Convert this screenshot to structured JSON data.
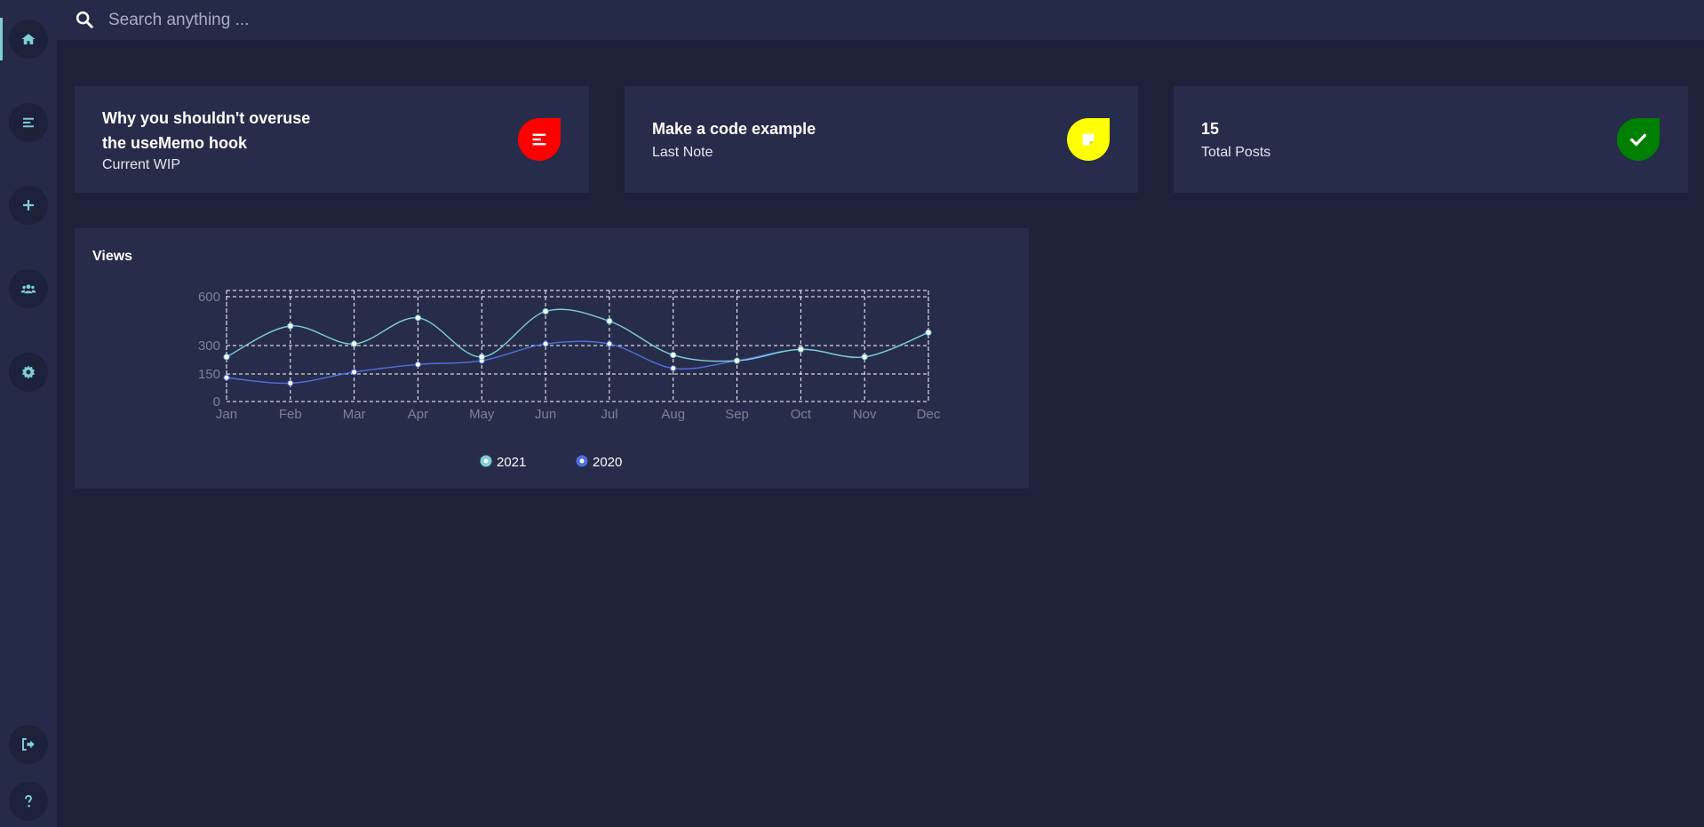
{
  "search": {
    "placeholder": "Search anything ..."
  },
  "sidebar": {
    "items": [
      {
        "name": "home-icon"
      },
      {
        "name": "list-icon"
      },
      {
        "name": "plus-icon"
      },
      {
        "name": "users-icon"
      },
      {
        "name": "gear-icon"
      },
      {
        "name": "logout-icon"
      },
      {
        "name": "help-icon"
      }
    ]
  },
  "cards": [
    {
      "title_line1": "Why you shouldn't overuse",
      "title_line2": "the useMemo hook",
      "subtitle": "Current WIP",
      "badge_color": "#ff0000",
      "icon": "align-left-icon"
    },
    {
      "title": "Make a code example",
      "subtitle": "Last Note",
      "badge_color": "#ffff00",
      "icon": "sticky-note-icon"
    },
    {
      "title": "15",
      "subtitle": "Total Posts",
      "badge_color": "#008000",
      "icon": "check-icon"
    }
  ],
  "colors": {
    "accent": "#7ecfd4",
    "background": "#1d2139",
    "panel": "#272c4a",
    "series_2021": "#7ecfd4",
    "series_2020": "#4f6fe0"
  },
  "chart_title": "Views",
  "chart_data": {
    "type": "line",
    "title": "Views",
    "categories": [
      "Jan",
      "Feb",
      "Mar",
      "Apr",
      "May",
      "Jun",
      "Jul",
      "Aug",
      "Sep",
      "Oct",
      "Nov",
      "Dec"
    ],
    "y_ticks": [
      0,
      150,
      300,
      600
    ],
    "ylim": [
      0,
      600
    ],
    "y_scale": "piecewise (0,150,300,600 equally spaced)",
    "grid": true,
    "legend_position": "bottom-center",
    "series": [
      {
        "name": "2021",
        "color": "#7ecfd4",
        "values": [
          240,
          420,
          310,
          470,
          240,
          510,
          450,
          250,
          220,
          280,
          240,
          380
        ]
      },
      {
        "name": "2020",
        "color": "#4f6fe0",
        "values": [
          130,
          100,
          160,
          200,
          220,
          310,
          310,
          180,
          220,
          280,
          240,
          380
        ]
      }
    ]
  }
}
